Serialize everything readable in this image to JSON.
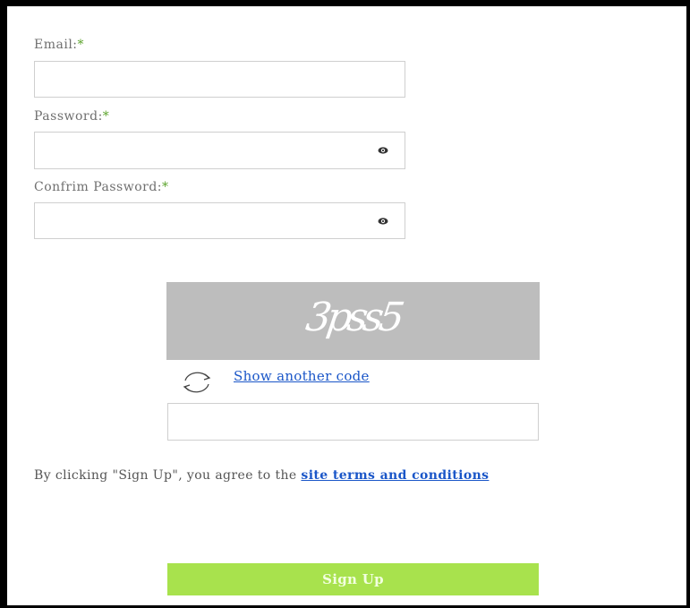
{
  "form": {
    "email_label": "Email:",
    "password_label": "Password:",
    "confirm_label": "Confrim Password:",
    "required_mark": "*",
    "email_value": "",
    "password_value": "",
    "confirm_value": ""
  },
  "captcha": {
    "code_text": "3pss5",
    "show_another_label": "Show another code",
    "input_value": ""
  },
  "terms": {
    "prefix": "By clicking \"Sign Up\", you agree to the ",
    "link_text": "site terms and conditions"
  },
  "signup_label": "Sign Up",
  "colors": {
    "accent": "#a8e24d",
    "required": "#5ba32b",
    "link": "#1a56c8",
    "captcha_bg": "#bdbdbd"
  },
  "icons": [
    "eye-icon",
    "refresh-icon"
  ]
}
